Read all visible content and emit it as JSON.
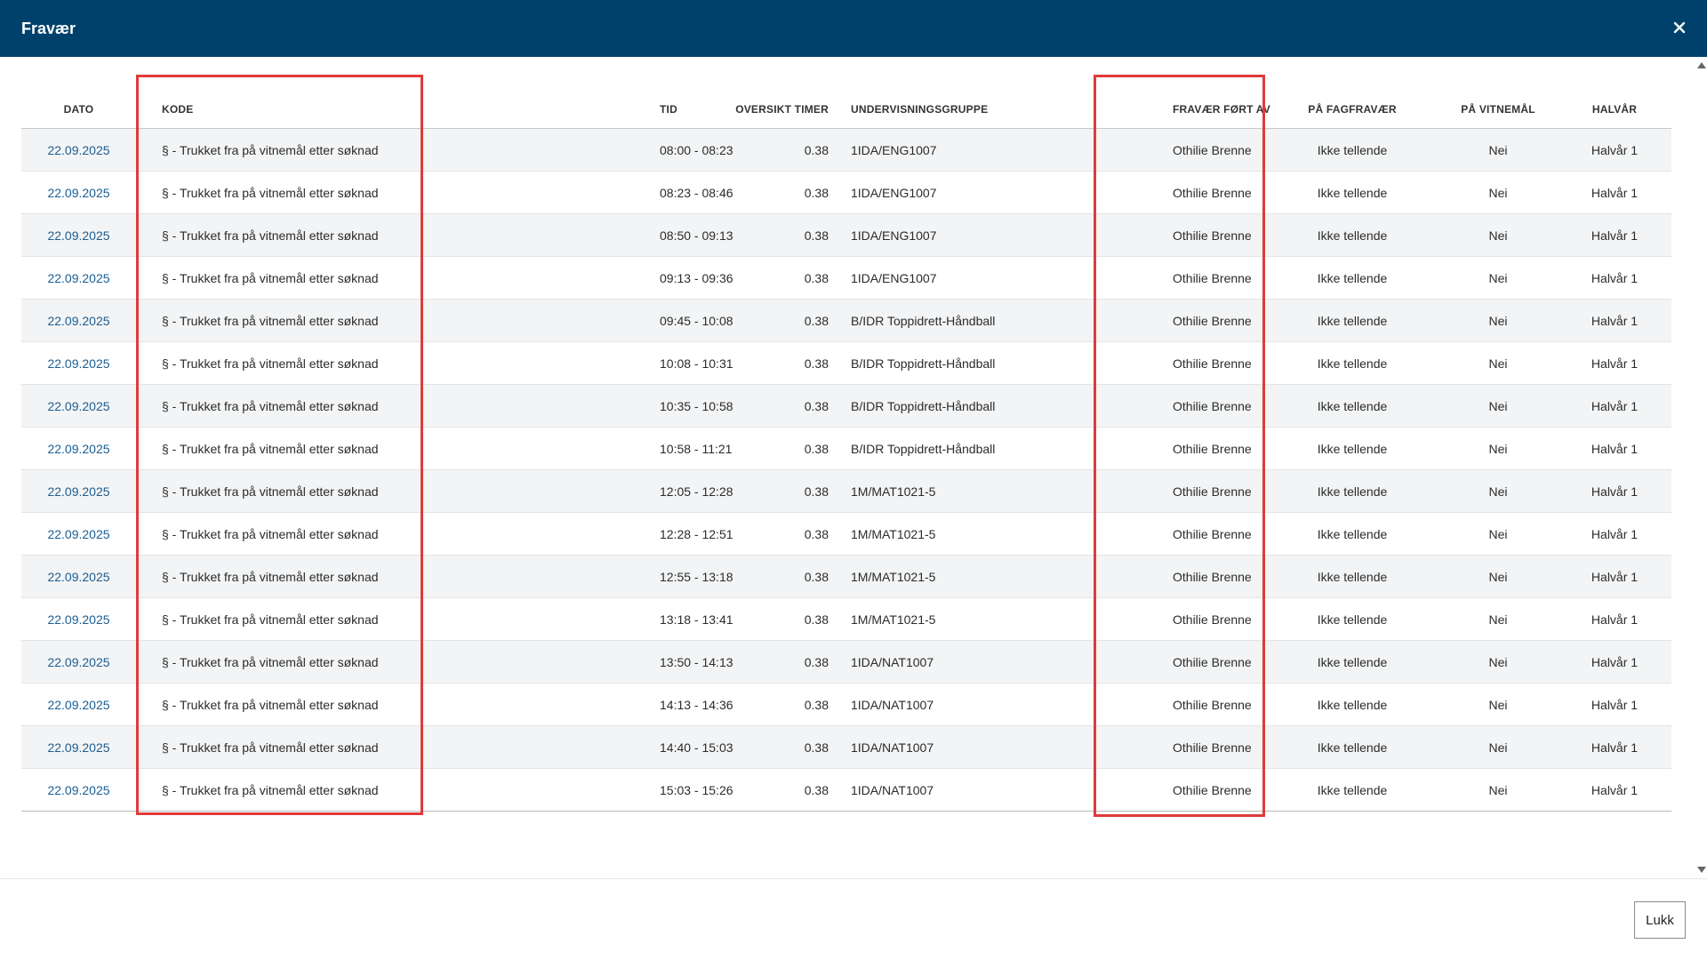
{
  "window": {
    "title": "Fravær",
    "close_icon": "close-icon"
  },
  "table": {
    "columns": [
      {
        "key": "dato",
        "label": "DATO"
      },
      {
        "key": "kode",
        "label": "KODE"
      },
      {
        "key": "tid",
        "label": "TID"
      },
      {
        "key": "timer",
        "label": "OVERSIKT TIMER"
      },
      {
        "key": "gruppe",
        "label": "UNDERVISNINGSGRUPPE"
      },
      {
        "key": "fort_av",
        "label": "FRAVÆR FØRT AV"
      },
      {
        "key": "fagfravaer",
        "label": "PÅ FAGFRAVÆR"
      },
      {
        "key": "vitnemal",
        "label": "PÅ VITNEMÅL"
      },
      {
        "key": "halvar",
        "label": "HALVÅR"
      }
    ],
    "rows": [
      {
        "dato": "22.09.2025",
        "kode": "§ - Trukket fra på vitnemål etter søknad",
        "tid": "08:00 - 08:23",
        "timer": "0.38",
        "gruppe": "1IDA/ENG1007",
        "fort_av": "Othilie Brenne",
        "fagfravaer": "Ikke tellende",
        "vitnemal": "Nei",
        "halvar": "Halvår 1"
      },
      {
        "dato": "22.09.2025",
        "kode": "§ - Trukket fra på vitnemål etter søknad",
        "tid": "08:23 - 08:46",
        "timer": "0.38",
        "gruppe": "1IDA/ENG1007",
        "fort_av": "Othilie Brenne",
        "fagfravaer": "Ikke tellende",
        "vitnemal": "Nei",
        "halvar": "Halvår 1"
      },
      {
        "dato": "22.09.2025",
        "kode": "§ - Trukket fra på vitnemål etter søknad",
        "tid": "08:50 - 09:13",
        "timer": "0.38",
        "gruppe": "1IDA/ENG1007",
        "fort_av": "Othilie Brenne",
        "fagfravaer": "Ikke tellende",
        "vitnemal": "Nei",
        "halvar": "Halvår 1"
      },
      {
        "dato": "22.09.2025",
        "kode": "§ - Trukket fra på vitnemål etter søknad",
        "tid": "09:13 - 09:36",
        "timer": "0.38",
        "gruppe": "1IDA/ENG1007",
        "fort_av": "Othilie Brenne",
        "fagfravaer": "Ikke tellende",
        "vitnemal": "Nei",
        "halvar": "Halvår 1"
      },
      {
        "dato": "22.09.2025",
        "kode": "§ - Trukket fra på vitnemål etter søknad",
        "tid": "09:45 - 10:08",
        "timer": "0.38",
        "gruppe": "B/IDR Toppidrett-Håndball",
        "fort_av": "Othilie Brenne",
        "fagfravaer": "Ikke tellende",
        "vitnemal": "Nei",
        "halvar": "Halvår 1"
      },
      {
        "dato": "22.09.2025",
        "kode": "§ - Trukket fra på vitnemål etter søknad",
        "tid": "10:08 - 10:31",
        "timer": "0.38",
        "gruppe": "B/IDR Toppidrett-Håndball",
        "fort_av": "Othilie Brenne",
        "fagfravaer": "Ikke tellende",
        "vitnemal": "Nei",
        "halvar": "Halvår 1"
      },
      {
        "dato": "22.09.2025",
        "kode": "§ - Trukket fra på vitnemål etter søknad",
        "tid": "10:35 - 10:58",
        "timer": "0.38",
        "gruppe": "B/IDR Toppidrett-Håndball",
        "fort_av": "Othilie Brenne",
        "fagfravaer": "Ikke tellende",
        "vitnemal": "Nei",
        "halvar": "Halvår 1"
      },
      {
        "dato": "22.09.2025",
        "kode": "§ - Trukket fra på vitnemål etter søknad",
        "tid": "10:58 - 11:21",
        "timer": "0.38",
        "gruppe": "B/IDR Toppidrett-Håndball",
        "fort_av": "Othilie Brenne",
        "fagfravaer": "Ikke tellende",
        "vitnemal": "Nei",
        "halvar": "Halvår 1"
      },
      {
        "dato": "22.09.2025",
        "kode": "§ - Trukket fra på vitnemål etter søknad",
        "tid": "12:05 - 12:28",
        "timer": "0.38",
        "gruppe": "1M/MAT1021-5",
        "fort_av": "Othilie Brenne",
        "fagfravaer": "Ikke tellende",
        "vitnemal": "Nei",
        "halvar": "Halvår 1"
      },
      {
        "dato": "22.09.2025",
        "kode": "§ - Trukket fra på vitnemål etter søknad",
        "tid": "12:28 - 12:51",
        "timer": "0.38",
        "gruppe": "1M/MAT1021-5",
        "fort_av": "Othilie Brenne",
        "fagfravaer": "Ikke tellende",
        "vitnemal": "Nei",
        "halvar": "Halvår 1"
      },
      {
        "dato": "22.09.2025",
        "kode": "§ - Trukket fra på vitnemål etter søknad",
        "tid": "12:55 - 13:18",
        "timer": "0.38",
        "gruppe": "1M/MAT1021-5",
        "fort_av": "Othilie Brenne",
        "fagfravaer": "Ikke tellende",
        "vitnemal": "Nei",
        "halvar": "Halvår 1"
      },
      {
        "dato": "22.09.2025",
        "kode": "§ - Trukket fra på vitnemål etter søknad",
        "tid": "13:18 - 13:41",
        "timer": "0.38",
        "gruppe": "1M/MAT1021-5",
        "fort_av": "Othilie Brenne",
        "fagfravaer": "Ikke tellende",
        "vitnemal": "Nei",
        "halvar": "Halvår 1"
      },
      {
        "dato": "22.09.2025",
        "kode": "§ - Trukket fra på vitnemål etter søknad",
        "tid": "13:50 - 14:13",
        "timer": "0.38",
        "gruppe": "1IDA/NAT1007",
        "fort_av": "Othilie Brenne",
        "fagfravaer": "Ikke tellende",
        "vitnemal": "Nei",
        "halvar": "Halvår 1"
      },
      {
        "dato": "22.09.2025",
        "kode": "§ - Trukket fra på vitnemål etter søknad",
        "tid": "14:13 - 14:36",
        "timer": "0.38",
        "gruppe": "1IDA/NAT1007",
        "fort_av": "Othilie Brenne",
        "fagfravaer": "Ikke tellende",
        "vitnemal": "Nei",
        "halvar": "Halvår 1"
      },
      {
        "dato": "22.09.2025",
        "kode": "§ - Trukket fra på vitnemål etter søknad",
        "tid": "14:40 - 15:03",
        "timer": "0.38",
        "gruppe": "1IDA/NAT1007",
        "fort_av": "Othilie Brenne",
        "fagfravaer": "Ikke tellende",
        "vitnemal": "Nei",
        "halvar": "Halvår 1"
      },
      {
        "dato": "22.09.2025",
        "kode": "§ - Trukket fra på vitnemål etter søknad",
        "tid": "15:03 - 15:26",
        "timer": "0.38",
        "gruppe": "1IDA/NAT1007",
        "fort_av": "Othilie Brenne",
        "fagfravaer": "Ikke tellende",
        "vitnemal": "Nei",
        "halvar": "Halvår 1"
      }
    ]
  },
  "footer": {
    "close_label": "Lukk"
  },
  "colors": {
    "header_bg": "#00416b",
    "link": "#1a5d93",
    "highlight": "#e03a3a",
    "row_stripe": "#f3f4f5"
  }
}
